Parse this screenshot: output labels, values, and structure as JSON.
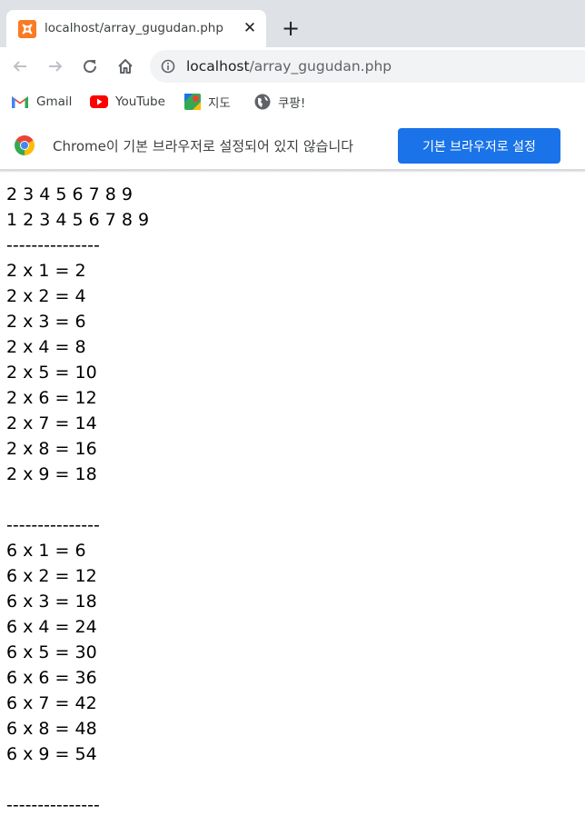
{
  "browser": {
    "tab_title": "localhost/array_gugudan.php",
    "new_tab_label": "+",
    "close_label": "✕",
    "url_host": "localhost",
    "url_path": "/array_gugudan.php"
  },
  "bookmarks": [
    {
      "label": "Gmail",
      "icon": "gmail-icon"
    },
    {
      "label": "YouTube",
      "icon": "youtube-icon"
    },
    {
      "label": "지도",
      "icon": "maps-icon"
    },
    {
      "label": "쿠팡!",
      "icon": "globe-icon"
    }
  ],
  "infobar": {
    "message": "Chrome이 기본 브라우저로 설정되어 있지 않습니다",
    "button_label": "기본 브라우저로 설정"
  },
  "content": {
    "lines": [
      "2 3 4 5 6 7 8 9",
      "1 2 3 4 5 6 7 8 9",
      "---------------",
      "2 x 1 = 2",
      "2 x 2 = 4",
      "2 x 3 = 6",
      "2 x 4 = 8",
      "2 x 5 = 10",
      "2 x 6 = 12",
      "2 x 7 = 14",
      "2 x 8 = 16",
      "2 x 9 = 18",
      "",
      "---------------",
      "6 x 1 = 6",
      "6 x 2 = 12",
      "6 x 3 = 18",
      "6 x 4 = 24",
      "6 x 5 = 30",
      "6 x 6 = 36",
      "6 x 7 = 42",
      "6 x 8 = 48",
      "6 x 9 = 54",
      "",
      "---------------"
    ]
  }
}
